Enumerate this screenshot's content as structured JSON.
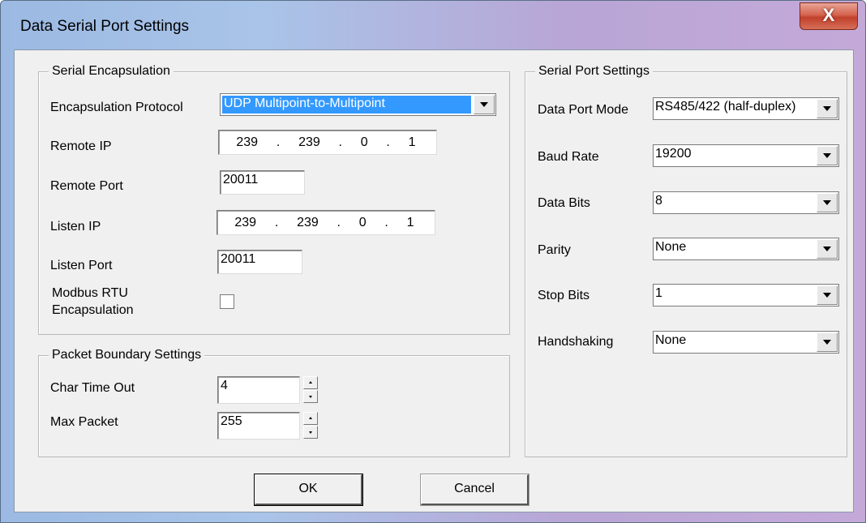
{
  "window": {
    "title": "Data Serial Port Settings",
    "close_glyph": "X"
  },
  "serial_encapsulation": {
    "group_label": "Serial Encapsulation",
    "protocol_label": "Encapsulation Protocol",
    "protocol_value": "UDP Multipoint-to-Multipoint",
    "remote_ip_label": "Remote IP",
    "remote_ip": [
      "239",
      "239",
      "0",
      "1"
    ],
    "remote_port_label": "Remote Port",
    "remote_port": "20011",
    "listen_ip_label": "Listen IP",
    "listen_ip": [
      "239",
      "239",
      "0",
      "1"
    ],
    "listen_port_label": "Listen Port",
    "listen_port": "20011",
    "modbus_label_line1": "Modbus RTU",
    "modbus_label_line2": "Encapsulation",
    "modbus_checked": false
  },
  "packet_boundary": {
    "group_label": "Packet Boundary Settings",
    "char_timeout_label": "Char Time Out",
    "char_timeout": "4",
    "max_packet_label": "Max Packet",
    "max_packet": "255"
  },
  "serial_port": {
    "group_label": "Serial Port Settings",
    "data_port_mode_label": "Data Port Mode",
    "data_port_mode": "RS485/422 (half-duplex)",
    "baud_rate_label": "Baud Rate",
    "baud_rate": "19200",
    "data_bits_label": "Data Bits",
    "data_bits": "8",
    "parity_label": "Parity",
    "parity": "None",
    "stop_bits_label": "Stop Bits",
    "stop_bits": "1",
    "handshaking_label": "Handshaking",
    "handshaking": "None"
  },
  "buttons": {
    "ok": "OK",
    "cancel": "Cancel"
  }
}
